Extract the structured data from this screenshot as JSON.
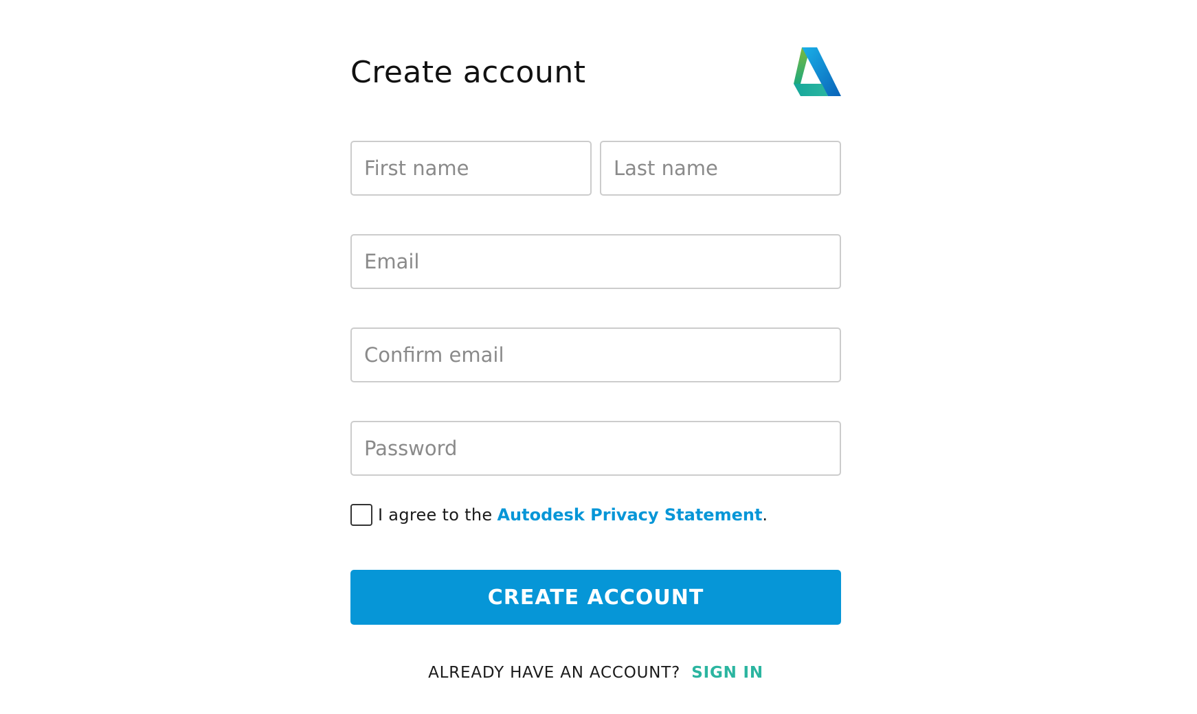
{
  "page": {
    "title": "Create account"
  },
  "logo": {
    "icon": "autodesk-logo-icon"
  },
  "form": {
    "first_name_placeholder": "First name",
    "last_name_placeholder": "Last name",
    "email_placeholder": "Email",
    "confirm_email_placeholder": "Confirm email",
    "password_placeholder": "Password",
    "agree_text": "I agree to the",
    "privacy_link": "Autodesk Privacy Statement",
    "agree_suffix": ".",
    "agree_checked": false,
    "submit_label": "CREATE ACCOUNT"
  },
  "footer": {
    "prompt": "ALREADY HAVE AN ACCOUNT?",
    "signin_label": "SIGN IN"
  },
  "colors": {
    "primary": "#0696d7",
    "link": "#0696d7",
    "signin": "#2bb5a0",
    "input_border": "#cccccc"
  }
}
